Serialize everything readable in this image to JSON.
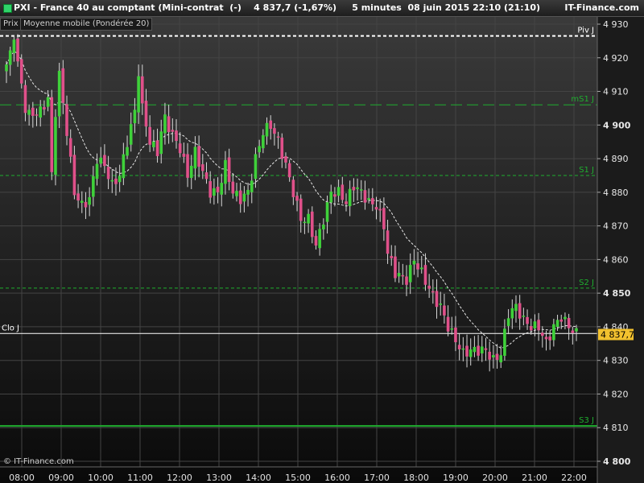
{
  "header": {
    "title": "PXI - France 40 au comptant (Mini-contrat  (-)    4 837,7 (-1,67%)     5 minutes  08 juin 2015 22:10 (21:10)",
    "brand": "IT-Finance.com"
  },
  "indicators": {
    "prix": "Prix",
    "ma": "Moyenne mobile (Pondérée 20)"
  },
  "copyright": "© IT-Finance.com",
  "colors": {
    "up": "#3fd13a",
    "down": "#e0508a",
    "grid": "#444444",
    "pivot": "#ffffff",
    "support_resistance": "#1fae2f",
    "last_price_bg": "#f2c12e"
  },
  "chart_data": {
    "type": "candlestick",
    "interval": "5 minutes",
    "ylim": [
      4800,
      4930
    ],
    "y_ticks": [
      {
        "value": 4930,
        "label": "4 930",
        "bold": false
      },
      {
        "value": 4920,
        "label": "4 920",
        "bold": false
      },
      {
        "value": 4910,
        "label": "4 910",
        "bold": false
      },
      {
        "value": 4900,
        "label": "4 900",
        "bold": true
      },
      {
        "value": 4890,
        "label": "4 890",
        "bold": false
      },
      {
        "value": 4880,
        "label": "4 880",
        "bold": false
      },
      {
        "value": 4870,
        "label": "4 870",
        "bold": false
      },
      {
        "value": 4860,
        "label": "4 860",
        "bold": false
      },
      {
        "value": 4850,
        "label": "4 850",
        "bold": true
      },
      {
        "value": 4840,
        "label": "4 840",
        "bold": false
      },
      {
        "value": 4830,
        "label": "4 830",
        "bold": false
      },
      {
        "value": 4820,
        "label": "4 820",
        "bold": false
      },
      {
        "value": 4810,
        "label": "4 810",
        "bold": false
      },
      {
        "value": 4800,
        "label": "4 800",
        "bold": true
      }
    ],
    "x_ticks": [
      "08:00",
      "09:00",
      "10:00",
      "11:00",
      "12:00",
      "13:00",
      "14:00",
      "15:00",
      "16:00",
      "17:00",
      "18:00",
      "19:00",
      "20:00",
      "21:00",
      "22:00"
    ],
    "levels": [
      {
        "label": "Piv J",
        "value": 4926.5,
        "style": "pivot"
      },
      {
        "label": "mS1 J",
        "value": 4906,
        "style": "long-dash"
      },
      {
        "label": "S1 J",
        "value": 4885,
        "style": "dash"
      },
      {
        "label": "S2 J",
        "value": 4851.5,
        "style": "dash"
      },
      {
        "label": "S3 J",
        "value": 4810.5,
        "style": "solid"
      },
      {
        "label": "Clo J",
        "value": 4838,
        "style": "close"
      }
    ],
    "last_price": {
      "label": "4 837,7",
      "value": 4837.7
    },
    "keypoints": [
      [
        0,
        4918
      ],
      [
        1,
        4921
      ],
      [
        2,
        4927
      ],
      [
        3,
        4918
      ],
      [
        4,
        4912
      ],
      [
        5,
        4905
      ],
      [
        6,
        4903
      ],
      [
        9,
        4904
      ],
      [
        10,
        4906
      ],
      [
        11,
        4908
      ],
      [
        12,
        4885
      ],
      [
        13,
        4904
      ],
      [
        14,
        4915
      ],
      [
        16,
        4898
      ],
      [
        18,
        4880
      ],
      [
        20,
        4876
      ],
      [
        22,
        4878
      ],
      [
        24,
        4890
      ],
      [
        26,
        4888
      ],
      [
        28,
        4882
      ],
      [
        30,
        4885
      ],
      [
        32,
        4895
      ],
      [
        34,
        4904
      ],
      [
        35,
        4916
      ],
      [
        36,
        4905
      ],
      [
        38,
        4895
      ],
      [
        40,
        4892
      ],
      [
        41,
        4898
      ],
      [
        42,
        4902
      ],
      [
        44,
        4897
      ],
      [
        46,
        4893
      ],
      [
        48,
        4885
      ],
      [
        50,
        4892
      ],
      [
        52,
        4886
      ],
      [
        54,
        4880
      ],
      [
        56,
        4880
      ],
      [
        58,
        4888
      ],
      [
        60,
        4880
      ],
      [
        62,
        4878
      ],
      [
        64,
        4880
      ],
      [
        66,
        4890
      ],
      [
        68,
        4898
      ],
      [
        70,
        4900
      ],
      [
        72,
        4895
      ],
      [
        74,
        4888
      ],
      [
        76,
        4880
      ],
      [
        78,
        4872
      ],
      [
        80,
        4872
      ],
      [
        82,
        4864
      ],
      [
        84,
        4872
      ],
      [
        86,
        4880
      ],
      [
        88,
        4880
      ],
      [
        90,
        4877
      ],
      [
        92,
        4882
      ],
      [
        94,
        4880
      ],
      [
        96,
        4877
      ],
      [
        98,
        4876
      ],
      [
        100,
        4870
      ],
      [
        101,
        4862
      ],
      [
        103,
        4856
      ],
      [
        106,
        4854
      ],
      [
        108,
        4860
      ],
      [
        110,
        4856
      ],
      [
        113,
        4849
      ],
      [
        115,
        4846
      ],
      [
        117,
        4840
      ],
      [
        119,
        4836
      ],
      [
        121,
        4832
      ],
      [
        123,
        4833
      ],
      [
        125,
        4833
      ],
      [
        127,
        4833
      ],
      [
        129,
        4830
      ],
      [
        131,
        4832
      ],
      [
        133,
        4844
      ],
      [
        135,
        4846
      ],
      [
        137,
        4842
      ],
      [
        139,
        4840
      ],
      [
        141,
        4840
      ],
      [
        143,
        4835
      ],
      [
        145,
        4840
      ],
      [
        147,
        4843
      ],
      [
        149,
        4840
      ],
      [
        151,
        4838
      ]
    ]
  }
}
